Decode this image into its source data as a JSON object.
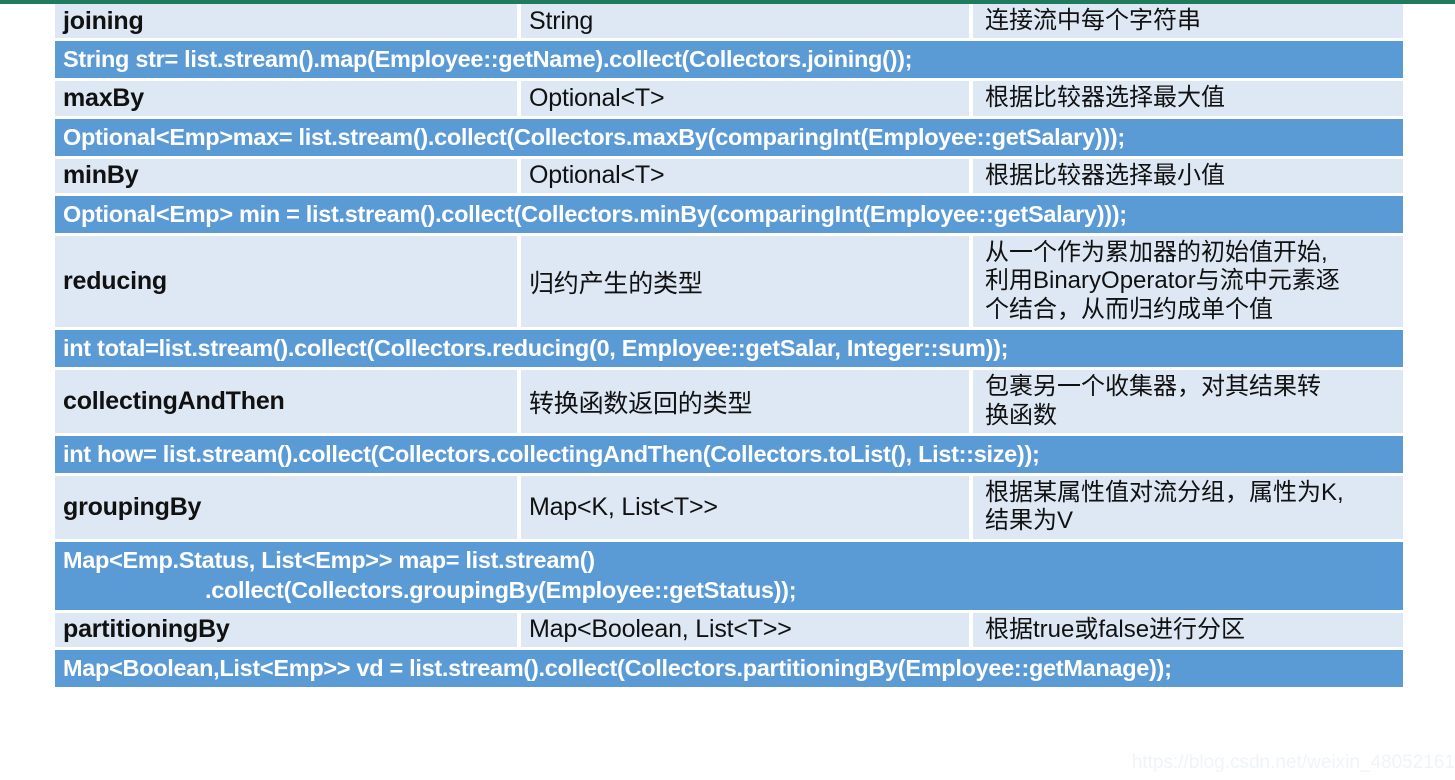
{
  "table": {
    "columns": [
      "collector",
      "return_type",
      "description"
    ],
    "rows": [
      {
        "kind": "entry",
        "name": "joining",
        "type": "String",
        "desc": [
          "连接流中每个字符串"
        ]
      },
      {
        "kind": "code",
        "lines": [
          "String str= list.stream().map(Employee::getName).collect(Collectors.joining());"
        ]
      },
      {
        "kind": "entry",
        "name": "maxBy",
        "type": "Optional<T>",
        "desc": [
          "根据比较器选择最大值"
        ]
      },
      {
        "kind": "code",
        "lines": [
          "Optional<Emp>max= list.stream().collect(Collectors.maxBy(comparingInt(Employee::getSalary)));"
        ]
      },
      {
        "kind": "entry",
        "name": "minBy",
        "type": "Optional<T>",
        "desc": [
          "根据比较器选择最小值"
        ]
      },
      {
        "kind": "code",
        "lines": [
          "Optional<Emp> min = list.stream().collect(Collectors.minBy(comparingInt(Employee::getSalary)));"
        ]
      },
      {
        "kind": "entry",
        "name": "reducing",
        "type": "归约产生的类型",
        "desc": [
          "从一个作为累加器的初始值开始,",
          "利用BinaryOperator与流中元素逐",
          "个结合，从而归约成单个值"
        ]
      },
      {
        "kind": "code",
        "lines": [
          "int total=list.stream().collect(Collectors.reducing(0, Employee::getSalar, Integer::sum));"
        ]
      },
      {
        "kind": "entry",
        "name": "collectingAndThen",
        "type": "转换函数返回的类型",
        "desc": [
          "包裹另一个收集器，对其结果转",
          "换函数"
        ]
      },
      {
        "kind": "code",
        "lines": [
          "int how= list.stream().collect(Collectors.collectingAndThen(Collectors.toList(), List::size));"
        ]
      },
      {
        "kind": "entry",
        "name": "groupingBy",
        "type": "Map<K, List<T>>",
        "desc": [
          "根据某属性值对流分组，属性为K,",
          "结果为V"
        ]
      },
      {
        "kind": "code",
        "lines": [
          "Map<Emp.Status, List<Emp>> map= list.stream()",
          ".collect(Collectors.groupingBy(Employee::getStatus));"
        ],
        "indent_second": true
      },
      {
        "kind": "entry",
        "name": "partitioningBy",
        "type": "Map<Boolean, List<T>>",
        "desc": [
          "根据true或false进行分区"
        ]
      },
      {
        "kind": "code",
        "lines": [
          "Map<Boolean,List<Emp>> vd = list.stream().collect(Collectors.partitioningBy(Employee::getManage));"
        ]
      }
    ]
  },
  "watermark": {
    "text": "https://blog.csdn.net/weixin_48052161"
  },
  "colors": {
    "cell_background": "#dde8f4",
    "code_background": "#5b9bd5",
    "code_text": "#ffffff",
    "cell_text": "#111111",
    "top_rule": "#1f7a5e"
  }
}
